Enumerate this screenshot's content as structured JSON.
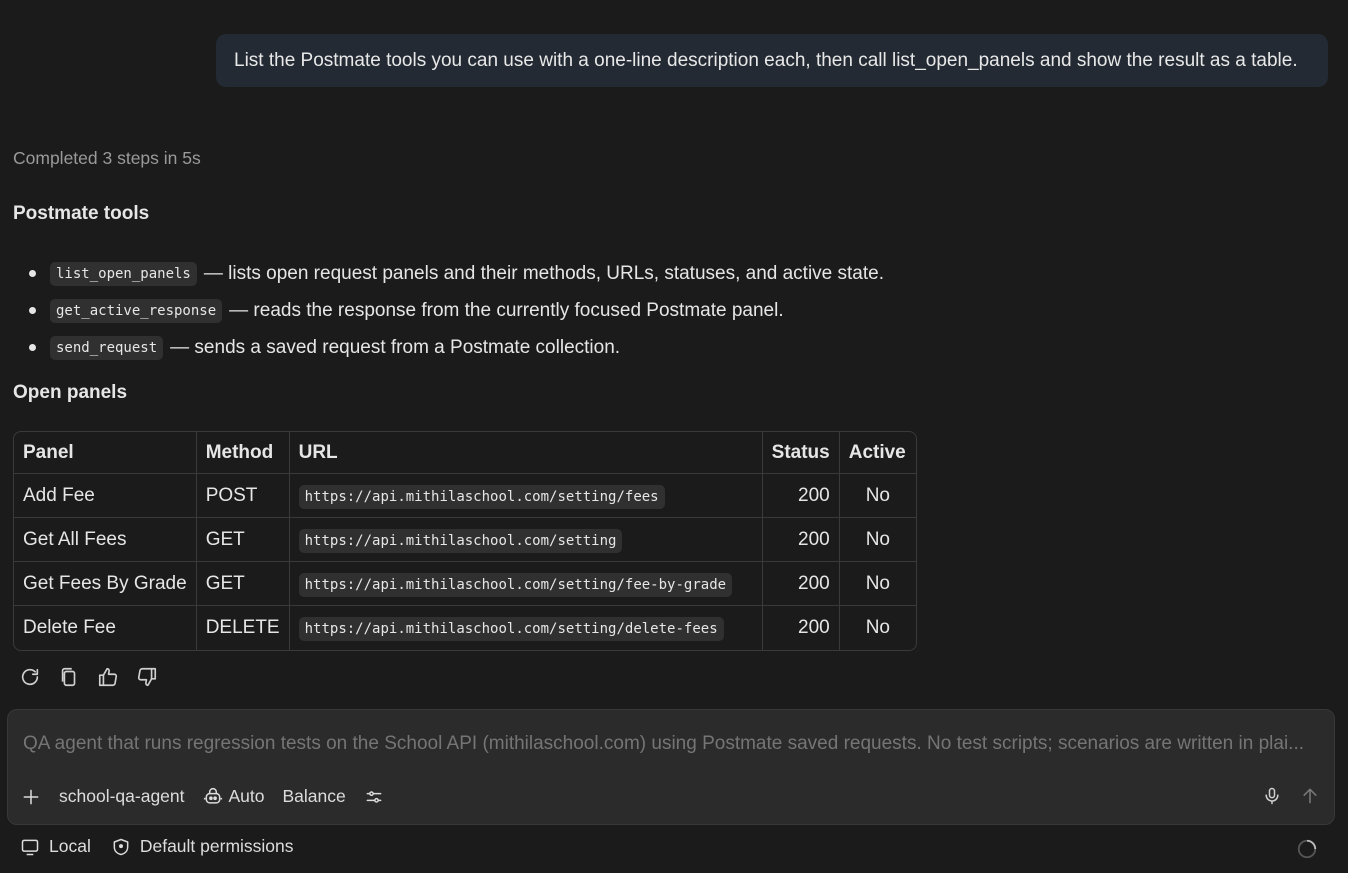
{
  "user_message": "List the Postmate tools you can use with a one-line description each, then call list_open_panels and show the result as a table.",
  "response": {
    "status": "Completed 3 steps in 5s",
    "tools_heading": "Postmate tools",
    "tools": [
      {
        "name": "list_open_panels",
        "description": "— lists open request panels and their methods, URLs, statuses, and active state."
      },
      {
        "name": "get_active_response",
        "description": "— reads the response from the currently focused Postmate panel."
      },
      {
        "name": "send_request",
        "description": "— sends a saved request from a Postmate collection."
      }
    ],
    "panels_heading": "Open panels",
    "table": {
      "headers": [
        "Panel",
        "Method",
        "URL",
        "Status",
        "Active"
      ],
      "rows": [
        {
          "panel": "Add Fee",
          "method": "POST",
          "url": "https://api.mithilaschool.com/setting/fees",
          "status": "200",
          "active": "No"
        },
        {
          "panel": "Get All Fees",
          "method": "GET",
          "url": "https://api.mithilaschool.com/setting",
          "status": "200",
          "active": "No"
        },
        {
          "panel": "Get Fees By Grade",
          "method": "GET",
          "url": "https://api.mithilaschool.com/setting/fee-by-grade",
          "status": "200",
          "active": "No"
        },
        {
          "panel": "Delete Fee",
          "method": "DELETE",
          "url": "https://api.mithilaschool.com/setting/delete-fees",
          "status": "200",
          "active": "No"
        }
      ]
    },
    "action_icons": [
      "retry-icon",
      "copy-icon",
      "thumbs-up-icon",
      "thumbs-down-icon"
    ]
  },
  "composer": {
    "placeholder": "QA agent that runs regression tests on the School API (mithilaschool.com) using Postmate saved requests. No test scripts; scenarios are written in plai...",
    "agent": "school-qa-agent",
    "model": "Auto",
    "mode": "Balance"
  },
  "footer": {
    "environment": "Local",
    "permissions": "Default permissions"
  },
  "colors": {
    "background": "#1b1b1b",
    "user_bubble": "#232a33",
    "composer_bg": "#2b2b2b",
    "code_bg": "#303030"
  }
}
